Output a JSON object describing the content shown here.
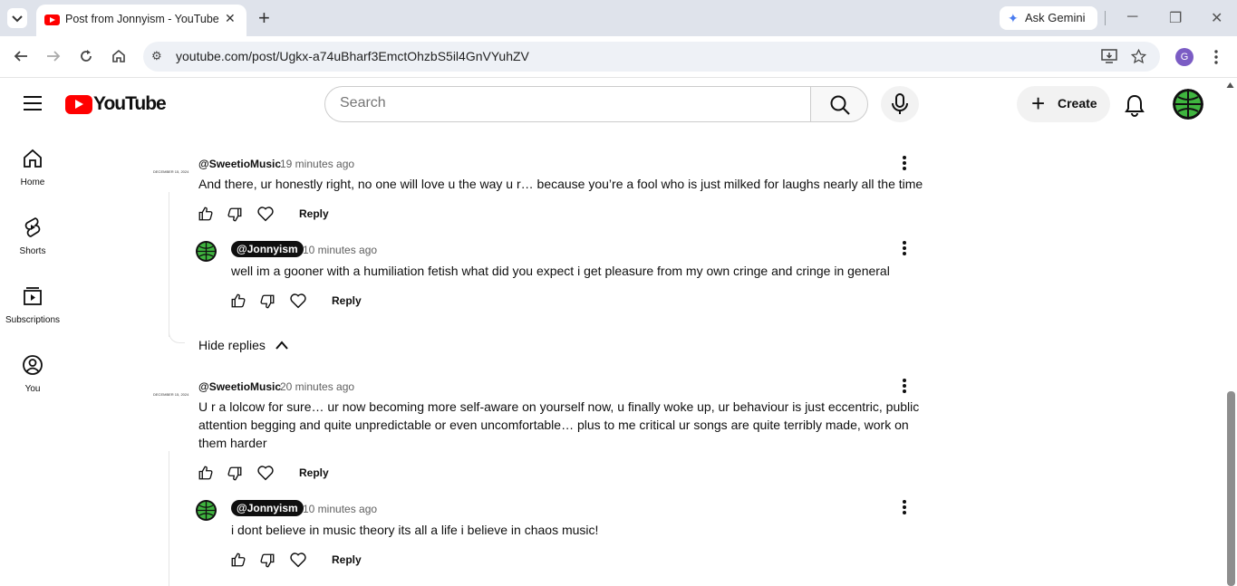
{
  "browser": {
    "tab_title": "Post from Jonnyism - YouTube",
    "close_glyph": "✕",
    "new_tab_glyph": "+",
    "gemini_label": "Ask Gemini",
    "url": "youtube.com/post/Ugkx-a74uBharf3EmctOhzbS5il4GnVYuhZV",
    "profile_initial": "G"
  },
  "header": {
    "logo_text": "YouTube",
    "search_placeholder": "Search",
    "create_label": "Create",
    "create_glyph": "+"
  },
  "sidebar": {
    "items": [
      {
        "label": "Home",
        "icon": "home-icon"
      },
      {
        "label": "Shorts",
        "icon": "shorts-icon"
      },
      {
        "label": "Subscriptions",
        "icon": "subscriptions-icon"
      },
      {
        "label": "You",
        "icon": "you-icon"
      }
    ]
  },
  "comments": [
    {
      "author": "@SweetioMusic",
      "avatar_text": "DECEMBER 15, 2024",
      "time": "19 minutes ago",
      "text": "And there, ur honestly right, no one will love u the way u r… because you’re a fool who is just milked for laughs nearly all the time",
      "reply_label": "Reply"
    },
    {
      "author": "@Jonnyism",
      "time": "10 minutes ago",
      "text": "well im a gooner with a humiliation fetish what did you expect i get pleasure from my own cringe and cringe in general",
      "reply_label": "Reply"
    },
    {
      "author": "@SweetioMusic",
      "avatar_text": "DECEMBER 15, 2024",
      "time": "20 minutes ago",
      "text_lines": [
        "U r a lolcow for sure… ur now becoming more self-aware on yourself now, u finally woke up, ur behaviour is just eccentric, public",
        "attention begging and quite unpredictable or even uncomfortable… plus to me critical ur songs are quite terribly made, work on",
        "them harder"
      ],
      "reply_label": "Reply"
    },
    {
      "author": "@Jonnyism",
      "time": "10 minutes ago",
      "text": "i dont believe in music theory its all a life i believe in chaos music!",
      "reply_label": "Reply"
    }
  ],
  "hide_replies_label": "Hide replies",
  "colors": {
    "brand_red": "#ff0000",
    "avatar_green": "#3fb53f",
    "text_primary": "#0f0f0f",
    "text_secondary": "#606060"
  }
}
